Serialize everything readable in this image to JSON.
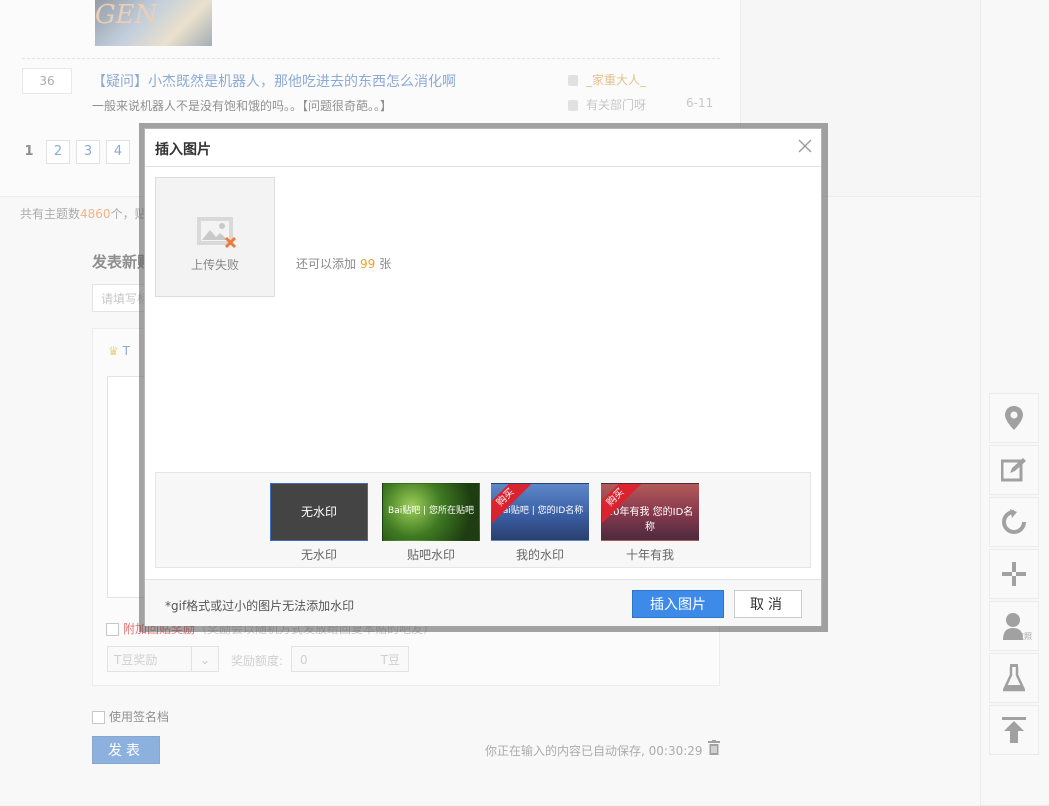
{
  "thread": {
    "reply_count": "36",
    "title_tag": "【疑问】",
    "title": "小杰既然是机器人，那他吃进去的东西怎么消化啊",
    "abstract": "一般来说机器人不是没有饱和饿的吗。。【问题很奇葩。。】",
    "author": "_家重大人_",
    "last_reply": "有关部门呀",
    "date": "6-11"
  },
  "avatar_text": "GEN",
  "pager": {
    "current": "1",
    "pages": [
      "2",
      "3",
      "4"
    ]
  },
  "topic_count": {
    "prefix": "共有主题数",
    "count": "4860",
    "suffix": "个，贴"
  },
  "post_form": {
    "heading": "发表新贴",
    "title_placeholder": "请填写标",
    "toolbar_prefix": "T",
    "reward_label": "附加回贴奖励",
    "reward_hint": "（奖励会以随机方式发放给回复本贴的吧友）",
    "tdou_select": "T豆奖励",
    "amount_label": "奖励额度:",
    "amount_value": "0",
    "amount_unit": "T豆",
    "signature_label": "使用签名档",
    "submit_label": "发表",
    "autosave_text": "你正在输入的内容已自动保存, 00:30:29"
  },
  "side_tools": {
    "items": [
      "location",
      "edit",
      "refresh",
      "plus",
      "user",
      "lab",
      "top"
    ],
    "user_caption": "夜照"
  },
  "dialog": {
    "title": "插入图片",
    "upload_status": "上传失败",
    "remain_prefix": "还可以添加",
    "remain_count": "99",
    "remain_suffix": "张",
    "watermarks": [
      {
        "thumb_text": "无水印",
        "caption": "无水印",
        "selected": true
      },
      {
        "thumb_text": "Bai贴吧 | 您所在贴吧",
        "caption": "贴吧水印",
        "selected": false
      },
      {
        "thumb_text": "Bai贴吧 | 您的ID名称",
        "caption": "我的水印",
        "ribbon": "购买",
        "selected": false
      },
      {
        "thumb_text": "10年有我 您的ID名称",
        "caption": "十年有我",
        "ribbon": "购买",
        "selected": false
      }
    ],
    "footnote": "*gif格式或过小的图片无法添加水印",
    "insert_label": "插入图片",
    "cancel_label": "取消"
  },
  "colors": {
    "accent": "#3d8ae8",
    "link": "#2d64b3",
    "highlight": "#e4761e",
    "ribbon": "#d9232e"
  }
}
